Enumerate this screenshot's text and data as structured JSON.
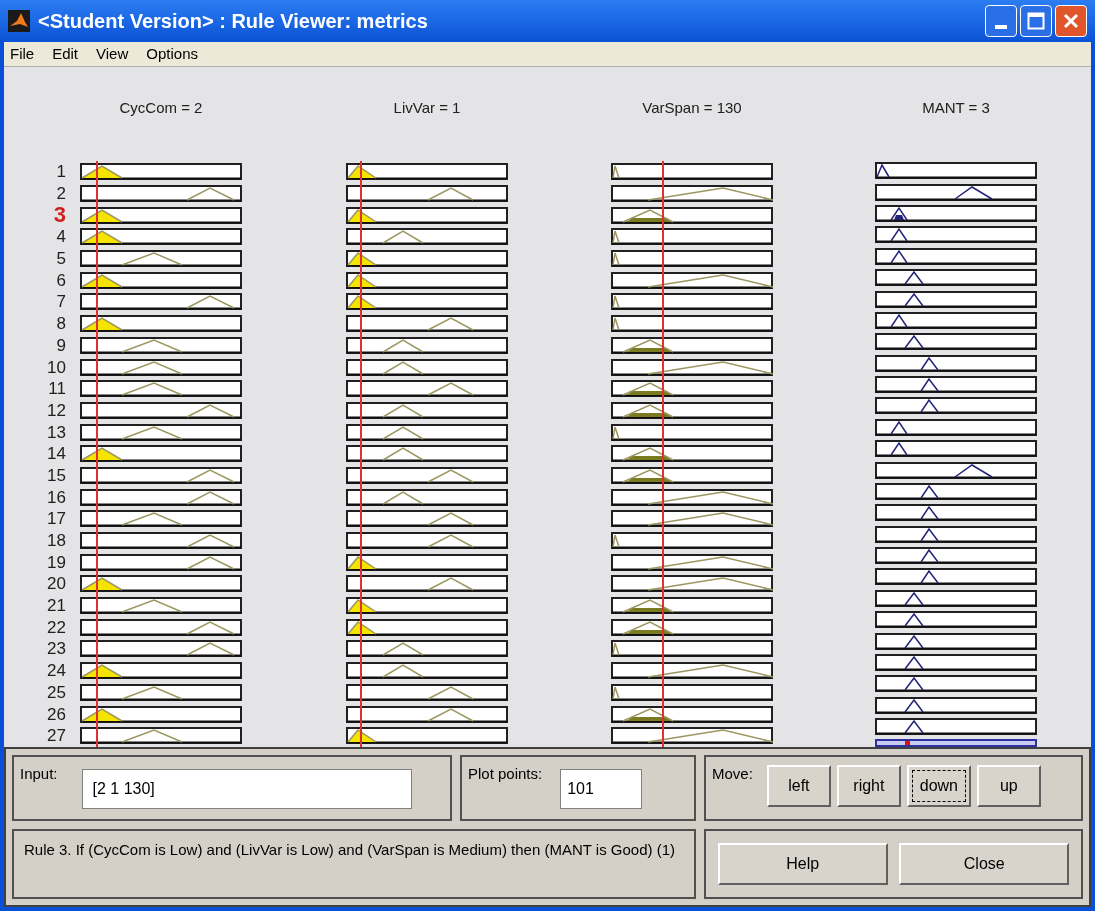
{
  "window": {
    "title": "<Student Version> : Rule Viewer: metrics"
  },
  "menu": [
    "File",
    "Edit",
    "View",
    "Options"
  ],
  "columns": [
    {
      "label": "CycCom = 2",
      "kind": "input"
    },
    {
      "label": "LivVar = 1",
      "kind": "input"
    },
    {
      "label": "VarSpan = 130",
      "kind": "input"
    },
    {
      "label": "MANT = 3",
      "kind": "output"
    }
  ],
  "rules": [
    {
      "number": "1",
      "selected": false,
      "cells": [
        {
          "kind": "low",
          "filled": true
        },
        {
          "kind": "low",
          "filled": true
        },
        {
          "kind": "low",
          "filled": false
        },
        {
          "kind": "mf1",
          "filled": false
        }
      ]
    },
    {
      "number": "2",
      "selected": false,
      "cells": [
        {
          "kind": "high",
          "filled": false
        },
        {
          "kind": "high",
          "filled": false
        },
        {
          "kind": "high",
          "filled": false
        },
        {
          "kind": "mf5",
          "filled": false
        }
      ]
    },
    {
      "number": "3",
      "selected": true,
      "cells": [
        {
          "kind": "low",
          "filled": true
        },
        {
          "kind": "low",
          "filled": true
        },
        {
          "kind": "medium",
          "filled": true
        },
        {
          "kind": "mf2",
          "filled": true
        }
      ]
    },
    {
      "number": "4",
      "selected": false,
      "cells": [
        {
          "kind": "low",
          "filled": true
        },
        {
          "kind": "medium",
          "filled": false
        },
        {
          "kind": "low",
          "filled": false
        },
        {
          "kind": "mf2",
          "filled": false
        }
      ]
    },
    {
      "number": "5",
      "selected": false,
      "cells": [
        {
          "kind": "medium",
          "filled": false
        },
        {
          "kind": "low",
          "filled": true
        },
        {
          "kind": "low",
          "filled": false
        },
        {
          "kind": "mf2",
          "filled": false
        }
      ]
    },
    {
      "number": "6",
      "selected": false,
      "cells": [
        {
          "kind": "low",
          "filled": true
        },
        {
          "kind": "low",
          "filled": true
        },
        {
          "kind": "high",
          "filled": false
        },
        {
          "kind": "mf3",
          "filled": false
        }
      ]
    },
    {
      "number": "7",
      "selected": false,
      "cells": [
        {
          "kind": "high",
          "filled": false
        },
        {
          "kind": "low",
          "filled": true
        },
        {
          "kind": "low",
          "filled": false
        },
        {
          "kind": "mf3",
          "filled": false
        }
      ]
    },
    {
      "number": "8",
      "selected": false,
      "cells": [
        {
          "kind": "low",
          "filled": true
        },
        {
          "kind": "high",
          "filled": false
        },
        {
          "kind": "low",
          "filled": false
        },
        {
          "kind": "mf2",
          "filled": false
        }
      ]
    },
    {
      "number": "9",
      "selected": false,
      "cells": [
        {
          "kind": "medium",
          "filled": false
        },
        {
          "kind": "medium",
          "filled": false
        },
        {
          "kind": "medium",
          "filled": true
        },
        {
          "kind": "mf3",
          "filled": false
        }
      ]
    },
    {
      "number": "10",
      "selected": false,
      "cells": [
        {
          "kind": "medium",
          "filled": false
        },
        {
          "kind": "medium",
          "filled": false
        },
        {
          "kind": "high",
          "filled": false
        },
        {
          "kind": "mf4",
          "filled": false
        }
      ]
    },
    {
      "number": "11",
      "selected": false,
      "cells": [
        {
          "kind": "medium",
          "filled": false
        },
        {
          "kind": "high",
          "filled": false
        },
        {
          "kind": "medium",
          "filled": true
        },
        {
          "kind": "mf4",
          "filled": false
        }
      ]
    },
    {
      "number": "12",
      "selected": false,
      "cells": [
        {
          "kind": "high",
          "filled": false
        },
        {
          "kind": "medium",
          "filled": false
        },
        {
          "kind": "medium",
          "filled": true
        },
        {
          "kind": "mf4",
          "filled": false
        }
      ]
    },
    {
      "number": "13",
      "selected": false,
      "cells": [
        {
          "kind": "medium",
          "filled": false
        },
        {
          "kind": "medium",
          "filled": false
        },
        {
          "kind": "low",
          "filled": false
        },
        {
          "kind": "mf2",
          "filled": false
        }
      ]
    },
    {
      "number": "14",
      "selected": false,
      "cells": [
        {
          "kind": "low",
          "filled": true
        },
        {
          "kind": "medium",
          "filled": false
        },
        {
          "kind": "medium",
          "filled": true
        },
        {
          "kind": "mf2",
          "filled": false
        }
      ]
    },
    {
      "number": "15",
      "selected": false,
      "cells": [
        {
          "kind": "high",
          "filled": false
        },
        {
          "kind": "high",
          "filled": false
        },
        {
          "kind": "medium",
          "filled": true
        },
        {
          "kind": "mf5",
          "filled": false
        }
      ]
    },
    {
      "number": "16",
      "selected": false,
      "cells": [
        {
          "kind": "high",
          "filled": false
        },
        {
          "kind": "medium",
          "filled": false
        },
        {
          "kind": "high",
          "filled": false
        },
        {
          "kind": "mf4",
          "filled": false
        }
      ]
    },
    {
      "number": "17",
      "selected": false,
      "cells": [
        {
          "kind": "medium",
          "filled": false
        },
        {
          "kind": "high",
          "filled": false
        },
        {
          "kind": "high",
          "filled": false
        },
        {
          "kind": "mf4",
          "filled": false
        }
      ]
    },
    {
      "number": "18",
      "selected": false,
      "cells": [
        {
          "kind": "high",
          "filled": false
        },
        {
          "kind": "high",
          "filled": false
        },
        {
          "kind": "low",
          "filled": false
        },
        {
          "kind": "mf4",
          "filled": false
        }
      ]
    },
    {
      "number": "19",
      "selected": false,
      "cells": [
        {
          "kind": "high",
          "filled": false
        },
        {
          "kind": "low",
          "filled": true
        },
        {
          "kind": "high",
          "filled": false
        },
        {
          "kind": "mf4",
          "filled": false
        }
      ]
    },
    {
      "number": "20",
      "selected": false,
      "cells": [
        {
          "kind": "low",
          "filled": true
        },
        {
          "kind": "high",
          "filled": false
        },
        {
          "kind": "high",
          "filled": false
        },
        {
          "kind": "mf4",
          "filled": false
        }
      ]
    },
    {
      "number": "21",
      "selected": false,
      "cells": [
        {
          "kind": "medium",
          "filled": false
        },
        {
          "kind": "low",
          "filled": true
        },
        {
          "kind": "medium",
          "filled": true
        },
        {
          "kind": "mf3",
          "filled": false
        }
      ]
    },
    {
      "number": "22",
      "selected": false,
      "cells": [
        {
          "kind": "high",
          "filled": false
        },
        {
          "kind": "low",
          "filled": true
        },
        {
          "kind": "medium",
          "filled": true
        },
        {
          "kind": "mf3",
          "filled": false
        }
      ]
    },
    {
      "number": "23",
      "selected": false,
      "cells": [
        {
          "kind": "high",
          "filled": false
        },
        {
          "kind": "medium",
          "filled": false
        },
        {
          "kind": "low",
          "filled": false
        },
        {
          "kind": "mf3",
          "filled": false
        }
      ]
    },
    {
      "number": "24",
      "selected": false,
      "cells": [
        {
          "kind": "low",
          "filled": true
        },
        {
          "kind": "medium",
          "filled": false
        },
        {
          "kind": "high",
          "filled": false
        },
        {
          "kind": "mf3",
          "filled": false
        }
      ]
    },
    {
      "number": "25",
      "selected": false,
      "cells": [
        {
          "kind": "medium",
          "filled": false
        },
        {
          "kind": "high",
          "filled": false
        },
        {
          "kind": "low",
          "filled": false
        },
        {
          "kind": "mf3",
          "filled": false
        }
      ]
    },
    {
      "number": "26",
      "selected": false,
      "cells": [
        {
          "kind": "low",
          "filled": true
        },
        {
          "kind": "high",
          "filled": false
        },
        {
          "kind": "medium",
          "filled": true
        },
        {
          "kind": "mf3",
          "filled": false
        }
      ]
    },
    {
      "number": "27",
      "selected": false,
      "cells": [
        {
          "kind": "medium",
          "filled": false
        },
        {
          "kind": "low",
          "filled": true
        },
        {
          "kind": "high",
          "filled": false
        },
        {
          "kind": "mf3",
          "filled": false
        }
      ]
    }
  ],
  "input": {
    "label": "Input:",
    "value": "[2 1 130]"
  },
  "plot_points": {
    "label": "Plot points:",
    "value": "101"
  },
  "move": {
    "label": "Move:",
    "buttons": [
      {
        "label": "left",
        "focused": false
      },
      {
        "label": "right",
        "focused": false
      },
      {
        "label": "down",
        "focused": true
      },
      {
        "label": "up",
        "focused": false
      }
    ]
  },
  "rule_text": "Rule 3. If (CycCom is Low) and (LivVar is Low) and (VarSpan is Medium) then (MANT is Good) (1)",
  "buttons": [
    "Help",
    "Close"
  ]
}
